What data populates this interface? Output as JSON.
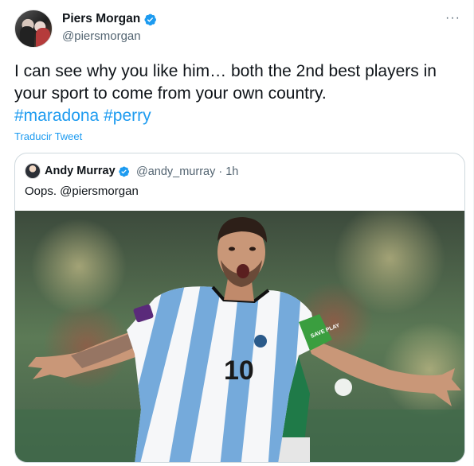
{
  "tweet": {
    "author_name": "Piers Morgan",
    "author_handle": "@piersmorgan",
    "text": "I can see why you like him… both the 2nd best players in your sport to come from your own country.",
    "hashtags": [
      "#maradona",
      "#perry"
    ],
    "translate_label": "Traducir Tweet",
    "more_label": "···"
  },
  "quoted": {
    "author_name": "Andy Murray",
    "author_handle_time": "@andy_murray · 1h",
    "text": "Oops. @piersmorgan",
    "jersey_number": "10",
    "armband_text": "SAVE PLAY"
  },
  "colors": {
    "accent": "#1d9bf0",
    "secondary_text": "#536471",
    "border": "#cfd9de",
    "jersey_blue": "#75aadb"
  },
  "icons": {
    "verified": "verified-badge-icon",
    "more": "more-dots-icon"
  }
}
